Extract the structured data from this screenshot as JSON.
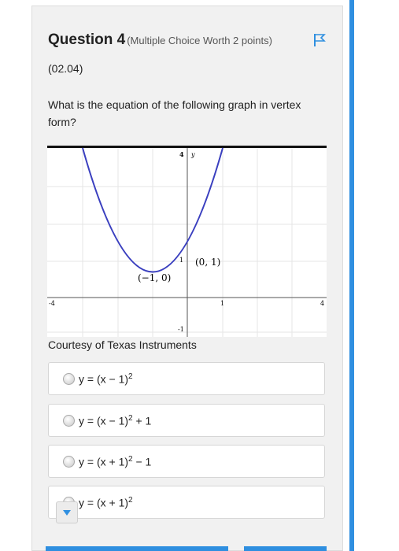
{
  "question": {
    "title": "Question 4",
    "meta": "(Multiple Choice Worth 2 points)",
    "code": "(02.04)",
    "prompt": "What is the equation of the following graph in vertex form?"
  },
  "graph": {
    "labels": {
      "y_axis": "y",
      "tick_x_neg": "-4",
      "tick_x_pos1": "1",
      "tick_x_pos4": "4",
      "tick_y_top": "4",
      "tick_y_1": "1",
      "tick_y_neg1": "-1",
      "point_a": "(0, 1)",
      "point_b": "(−1, 0)"
    },
    "curve_color": "#3a3fbf"
  },
  "courtesy": "Courtesy of Texas Instruments",
  "choices": [
    {
      "base": "y = (x − 1)",
      "exp": "2",
      "tail": ""
    },
    {
      "base": "y = (x − 1)",
      "exp": "2",
      "tail": " + 1"
    },
    {
      "base": "y = (x + 1)",
      "exp": "2",
      "tail": " − 1"
    },
    {
      "base": "y = (x + 1)",
      "exp": "2",
      "tail": ""
    }
  ],
  "icons": {
    "flag": "flag-icon",
    "caret": "caret-down-icon",
    "radio": "radio-icon"
  },
  "accent_color": "#2f8fe0"
}
